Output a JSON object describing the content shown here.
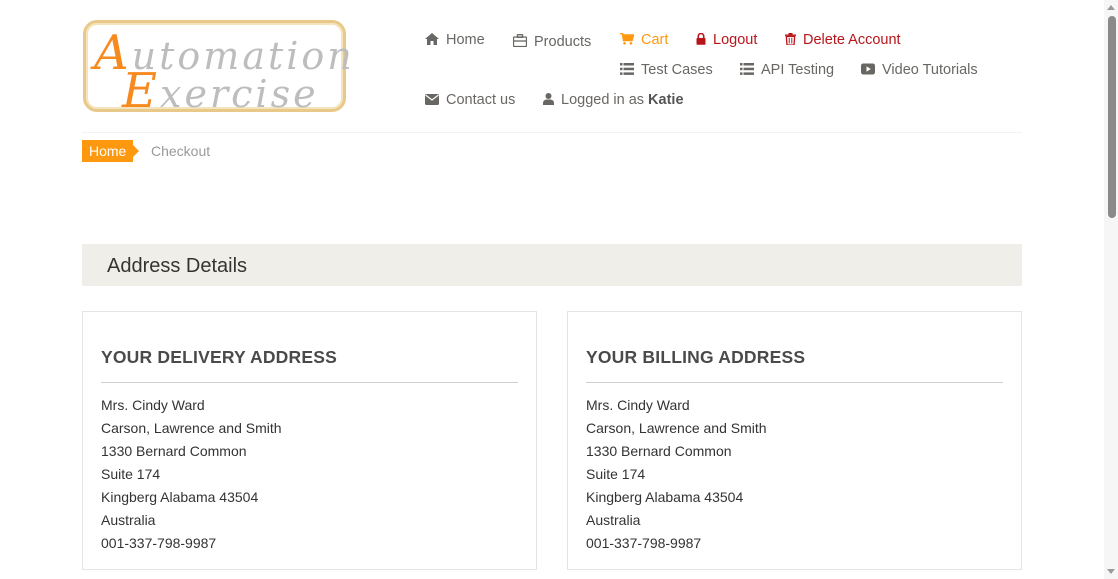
{
  "logo": {
    "line1_cap": "A",
    "line1_rest": "utomation",
    "line2_cap": "E",
    "line2_rest": "xercise"
  },
  "nav": {
    "home": "Home",
    "products": "Products",
    "cart": "Cart",
    "logout": "Logout",
    "delete_account": "Delete Account",
    "test_cases": "Test Cases",
    "api_testing": "API Testing",
    "video_tutorials": "Video Tutorials",
    "contact_us": "Contact us",
    "logged_in_as": "Logged in as",
    "username": "Katie"
  },
  "breadcrumb": {
    "home": "Home",
    "current": "Checkout"
  },
  "section_title": "Address Details",
  "delivery": {
    "title": "YOUR DELIVERY ADDRESS",
    "lines": [
      "Mrs. Cindy Ward",
      "Carson, Lawrence and Smith",
      "1330 Bernard Common",
      "Suite 174",
      "Kingberg Alabama 43504",
      "Australia",
      "001-337-798-9987"
    ]
  },
  "billing": {
    "title": "YOUR BILLING ADDRESS",
    "lines": [
      "Mrs. Cindy Ward",
      "Carson, Lawrence and Smith",
      "1330 Bernard Common",
      "Suite 174",
      "Kingberg Alabama 43504",
      "Australia",
      "001-337-798-9987"
    ]
  },
  "colors": {
    "accent": "#fe980f",
    "danger": "#b8151b",
    "section_bg": "#f0eee9"
  },
  "icons": {
    "home": "home-icon",
    "products": "briefcase-icon",
    "cart": "shopping-cart-icon",
    "logout": "lock-icon",
    "delete": "trash-icon",
    "test_cases": "list-icon",
    "api_testing": "list-icon",
    "video": "youtube-play-icon",
    "contact": "envelope-icon",
    "user": "user-icon"
  }
}
